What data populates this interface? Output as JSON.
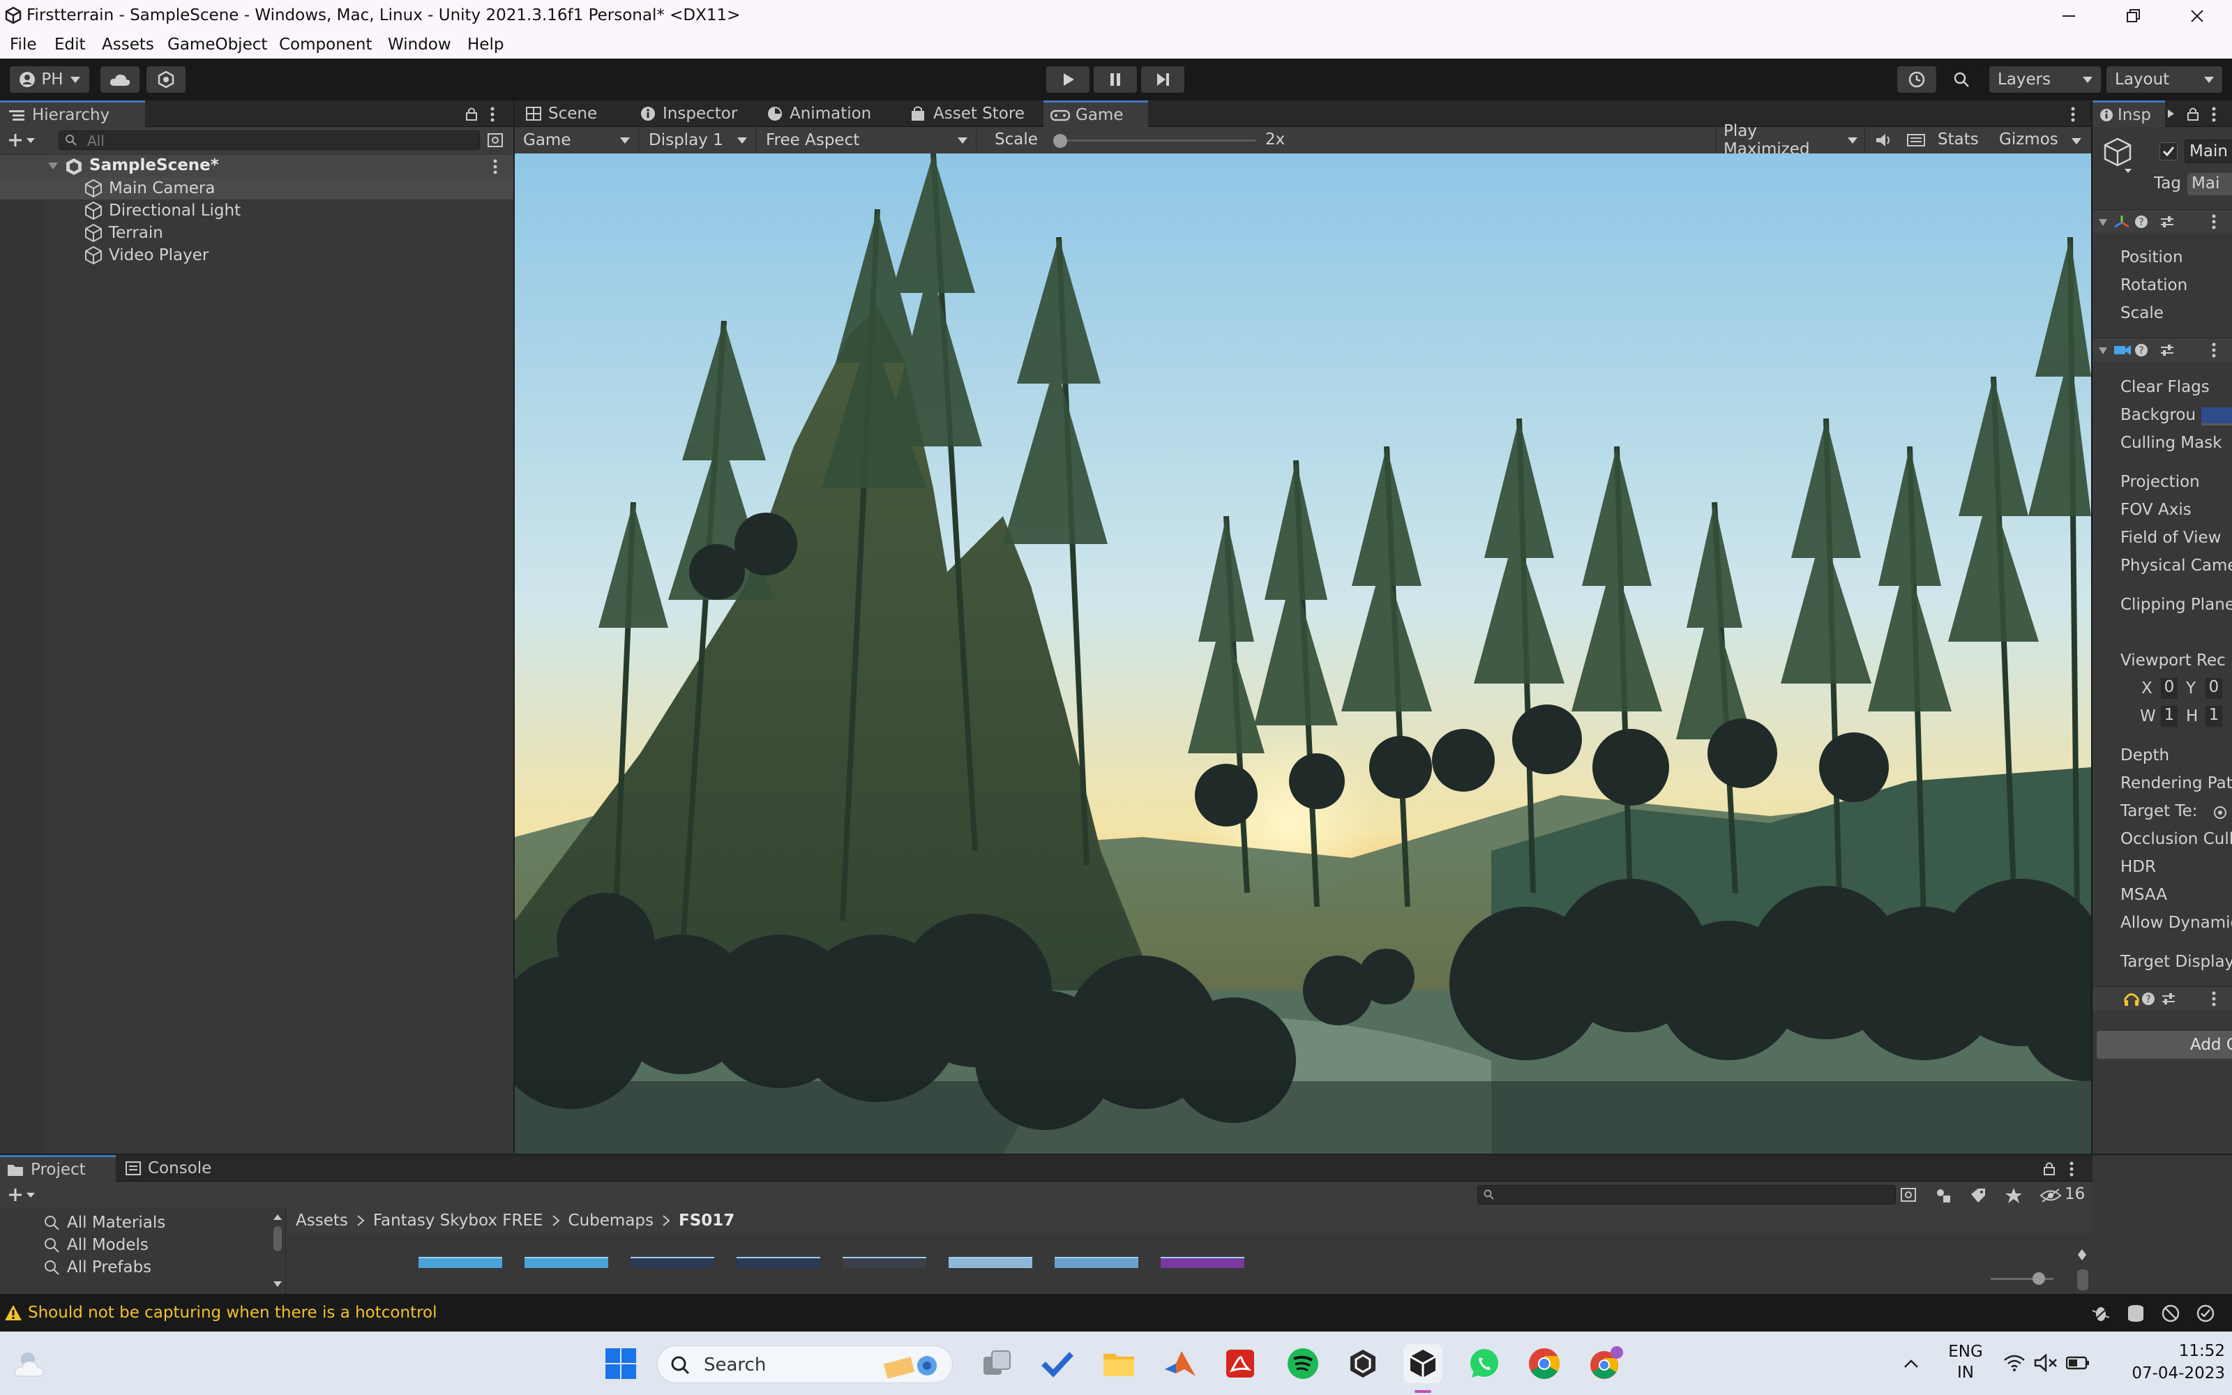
{
  "window": {
    "title": "Firstterrain - SampleScene - Windows, Mac, Linux - Unity 2021.3.16f1 Personal* <DX11>"
  },
  "menu": [
    "File",
    "Edit",
    "Assets",
    "GameObject",
    "Component",
    "Window",
    "Help"
  ],
  "toolbar": {
    "account": "PH",
    "layers": "Layers",
    "layout": "Layout"
  },
  "hierarchy": {
    "tab": "Hierarchy",
    "search_placeholder": "All",
    "scene": "SampleScene*",
    "items": [
      "Main Camera",
      "Directional Light",
      "Terrain",
      "Video Player"
    ]
  },
  "center_tabs": [
    "Scene",
    "Inspector",
    "Animation",
    "Asset Store",
    "Game"
  ],
  "game_bar": {
    "view": "Game",
    "display": "Display 1",
    "aspect": "Free Aspect",
    "scale_label": "Scale",
    "scale_value": "2x",
    "scale_fraction": 0.0,
    "play_mode": "Play Maximized",
    "stats": "Stats",
    "gizmos": "Gizmos"
  },
  "inspector": {
    "tab": "Insp",
    "object_name": "Main",
    "tag_label": "Tag",
    "tag_value": "Mai",
    "transform": [
      "Position",
      "Rotation",
      "Scale"
    ],
    "camera": [
      "Clear Flags",
      "Backgrou",
      "Culling Mask",
      "Projection",
      "FOV Axis",
      "Field of View",
      "Physical Came",
      "Clipping Plane",
      "Viewport Rec",
      "Depth",
      "Rendering Pat",
      "Target Te:",
      "Occlusion Cull",
      "HDR",
      "MSAA",
      "Allow Dynamic",
      "Target Display"
    ],
    "viewport": {
      "x_label": "X",
      "x": "0",
      "y_label": "Y",
      "y": "0",
      "w_label": "W",
      "w": "1",
      "h_label": "H",
      "h": "1"
    },
    "add_component": "Add C",
    "background_color": "#2f4c8a"
  },
  "bottom_tabs": [
    "Project",
    "Console"
  ],
  "project": {
    "favorites": [
      "All Materials",
      "All Models",
      "All Prefabs"
    ],
    "breadcrumb": [
      "Assets",
      "Fantasy Skybox FREE",
      "Cubemaps",
      "FS017"
    ],
    "hidden_count": "16",
    "thumb_colors": [
      "#4aa3d8",
      "#4aa3d8",
      "#2b3a55",
      "#2b3a55",
      "#3a3f48",
      "#8fb8d8",
      "#6aa0d0",
      "#7a3aa0"
    ]
  },
  "status": {
    "message": "Should not be capturing when there is a hotcontrol"
  },
  "taskbar": {
    "search": "Search",
    "lang_line1": "ENG",
    "lang_line2": "IN",
    "time": "11:52",
    "date": "07-04-2023"
  },
  "colors": {
    "accent": "#3a79bb",
    "warning": "#f2c12e"
  }
}
